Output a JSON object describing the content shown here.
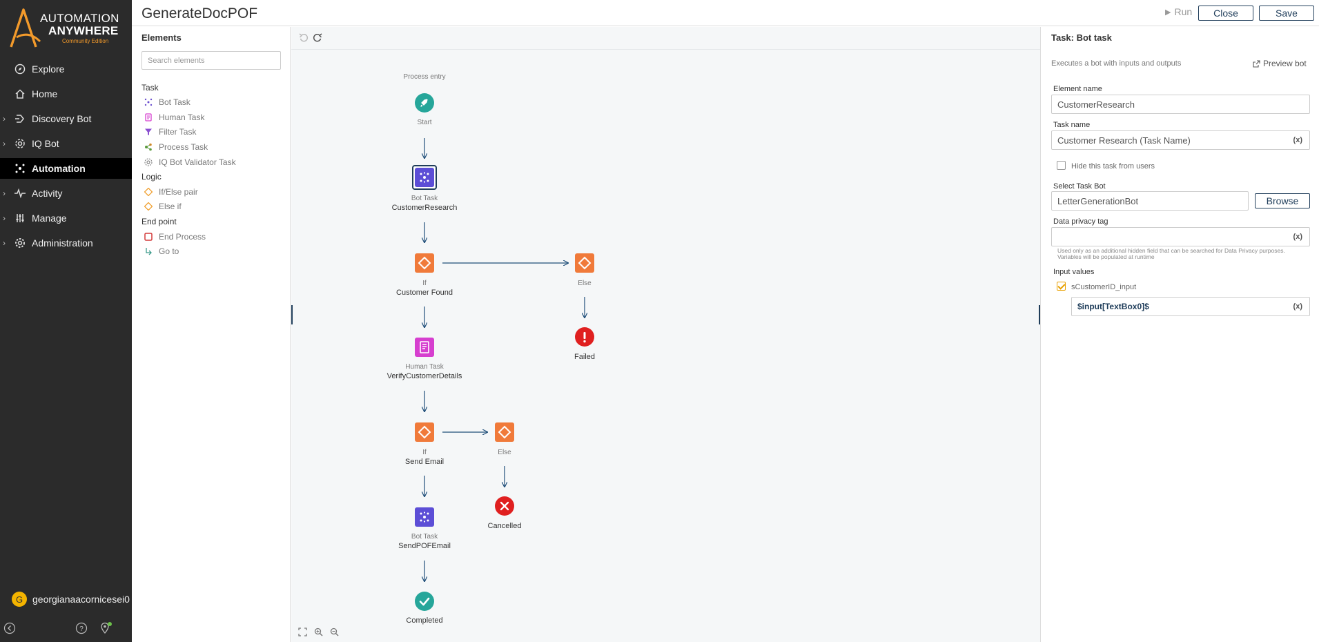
{
  "app": {
    "brand_line1": "AUTOMATION",
    "brand_line2": "ANYWHERE",
    "brand_edition": "Community Edition",
    "accent_color": "#f39a2b"
  },
  "nav": {
    "items": [
      {
        "label": "Explore",
        "icon": "compass-icon",
        "expandable": false
      },
      {
        "label": "Home",
        "icon": "home-icon",
        "expandable": false
      },
      {
        "label": "Discovery Bot",
        "icon": "discovery-icon",
        "expandable": true
      },
      {
        "label": "IQ Bot",
        "icon": "iq-bot-icon",
        "expandable": true
      },
      {
        "label": "Automation",
        "icon": "automation-icon",
        "expandable": false,
        "active": true
      },
      {
        "label": "Activity",
        "icon": "activity-icon",
        "expandable": true
      },
      {
        "label": "Manage",
        "icon": "sliders-icon",
        "expandable": true
      },
      {
        "label": "Administration",
        "icon": "gear-icon",
        "expandable": true
      }
    ],
    "user": {
      "initial": "G",
      "name": "georgianaacornicesei0"
    }
  },
  "header": {
    "title": "GenerateDocPOF",
    "run_label": "Run",
    "close_label": "Close",
    "save_label": "Save"
  },
  "elements_panel": {
    "title": "Elements",
    "search_placeholder": "Search elements",
    "categories": [
      {
        "label": "Task",
        "items": [
          {
            "label": "Bot Task",
            "icon": "bot-task-icon",
            "color": "#6b4fcf"
          },
          {
            "label": "Human Task",
            "icon": "human-task-icon",
            "color": "#d63fcf"
          },
          {
            "label": "Filter Task",
            "icon": "filter-icon",
            "color": "#8a4fd0"
          },
          {
            "label": "Process Task",
            "icon": "process-task-icon",
            "color": "#5a9a3c"
          },
          {
            "label": "IQ Bot Validator Task",
            "icon": "iq-validator-icon",
            "color": "#888888"
          }
        ]
      },
      {
        "label": "Logic",
        "items": [
          {
            "label": "If/Else pair",
            "icon": "diamond-icon",
            "color": "#f0a030"
          },
          {
            "label": "Else if",
            "icon": "diamond-icon",
            "color": "#f0a030"
          }
        ]
      },
      {
        "label": "End point",
        "items": [
          {
            "label": "End Process",
            "icon": "end-process-icon",
            "color": "#d33a3a"
          },
          {
            "label": "Go to",
            "icon": "goto-icon",
            "color": "#3a9a8a"
          }
        ]
      }
    ]
  },
  "flow": {
    "process_entry": "Process entry",
    "nodes": {
      "start": {
        "sub": "Start",
        "color": "#26a69a"
      },
      "bot1": {
        "type": "Bot Task",
        "name": "CustomerResearch",
        "color": "#5c4ed6"
      },
      "if1": {
        "type": "If",
        "name": "Customer Found",
        "color": "#f07a3a"
      },
      "else1": {
        "type": "Else",
        "color": "#f07a3a"
      },
      "failed": {
        "name": "Failed",
        "color": "#e02020"
      },
      "human": {
        "type": "Human Task",
        "name": "VerifyCustomerDetails",
        "color": "#d63fcf"
      },
      "if2": {
        "type": "If",
        "name": "Send Email",
        "color": "#f07a3a"
      },
      "else2": {
        "type": "Else",
        "color": "#f07a3a"
      },
      "cancelled": {
        "name": "Cancelled",
        "color": "#e02020"
      },
      "bot2": {
        "type": "Bot Task",
        "name": "SendPOFEmail",
        "color": "#5c4ed6"
      },
      "completed": {
        "name": "Completed",
        "color": "#26a69a"
      }
    },
    "edge_color": "#1f4e79"
  },
  "props": {
    "title": "Task: Bot task",
    "description": "Executes a bot with inputs and outputs",
    "preview_label": "Preview bot",
    "element_name_label": "Element name",
    "element_name_value": "CustomerResearch",
    "task_name_label": "Task name",
    "task_name_value": "Customer Research (Task Name)",
    "hide_label": "Hide this task from users",
    "hide_checked": false,
    "select_bot_label": "Select Task Bot",
    "select_bot_value": "LetterGenerationBot",
    "browse_label": "Browse",
    "privacy_label": "Data privacy tag",
    "privacy_value": "",
    "privacy_note_1": "Used only as an additional hidden field that can be searched for Data Privacy purposes.",
    "privacy_note_2": "Variables will be populated at runtime",
    "input_values_label": "Input values",
    "input_var_label": "sCustomerID_input",
    "input_var_checked": true,
    "input_var_value": "$input[TextBox0]$",
    "var_button": "(x)"
  }
}
